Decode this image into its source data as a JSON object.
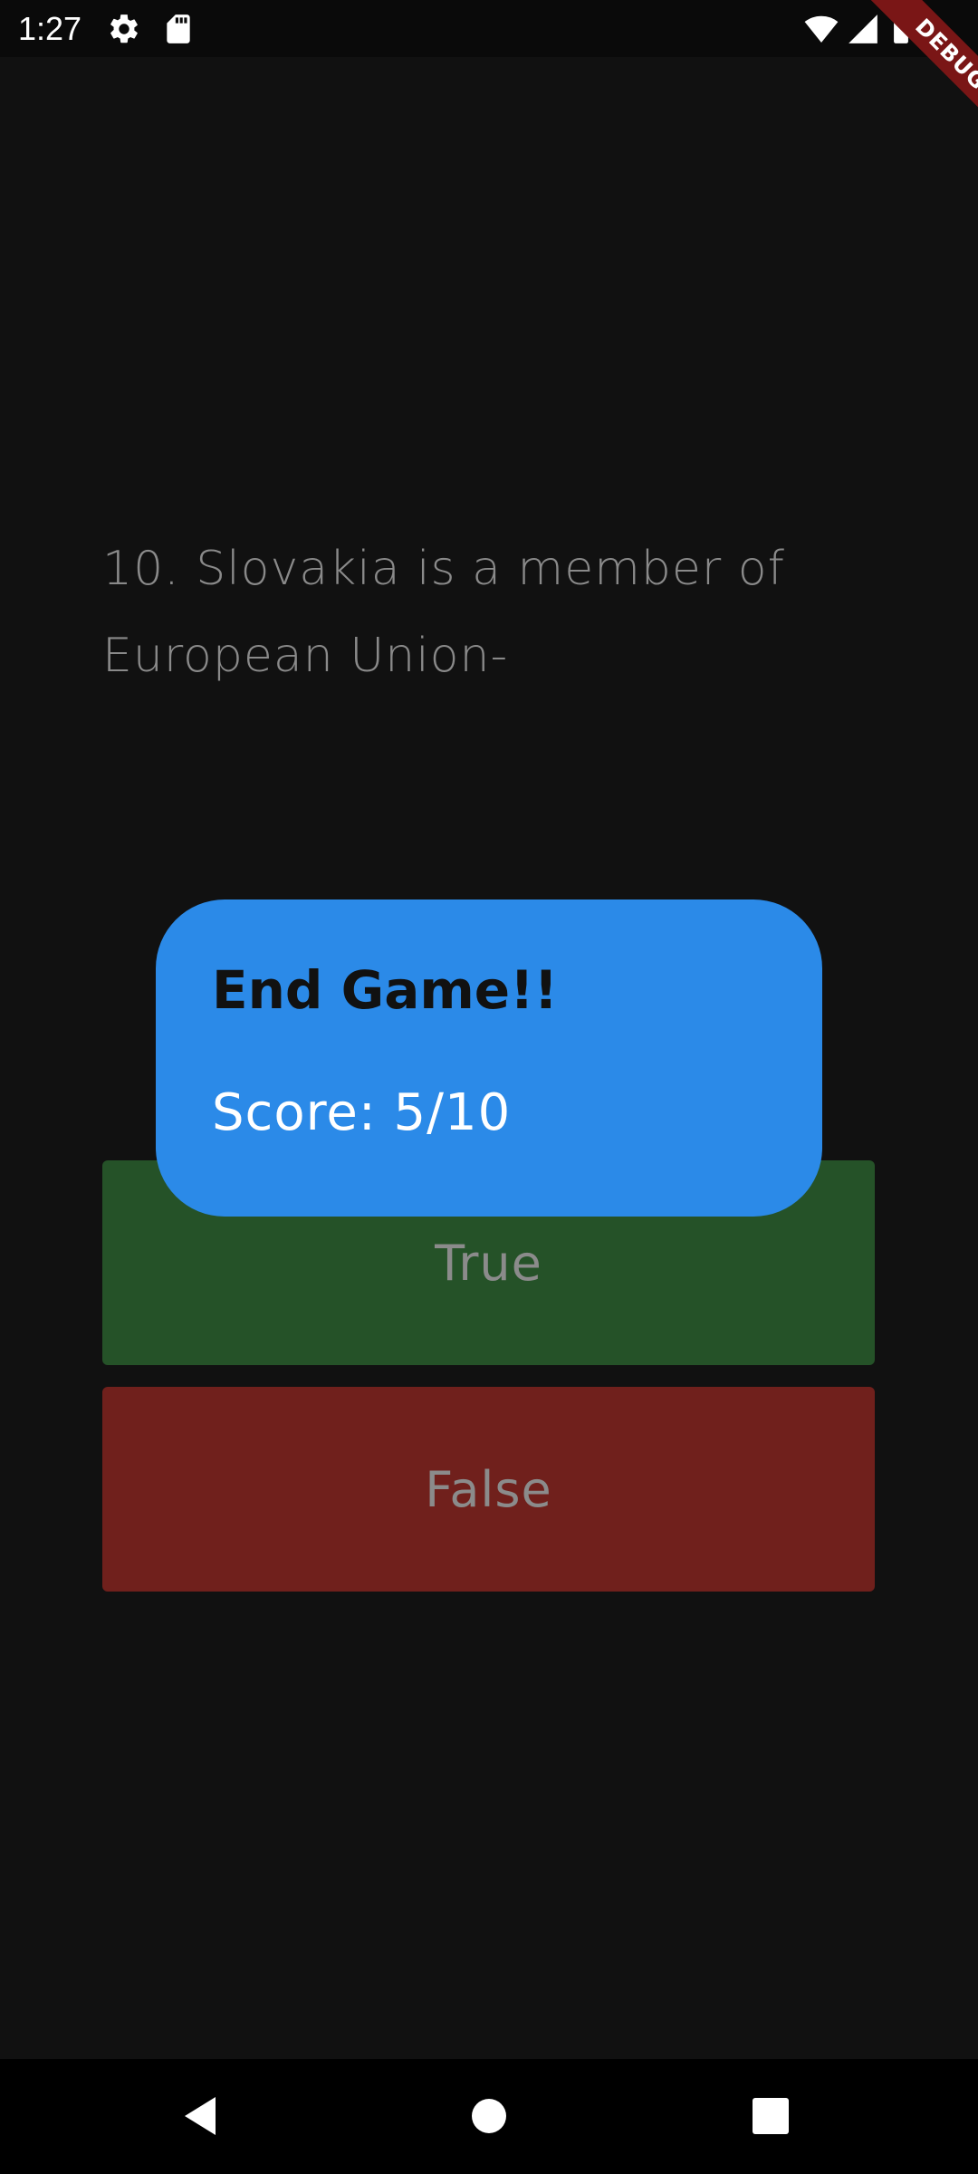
{
  "status_bar": {
    "time": "1:27",
    "icons": [
      "settings-icon",
      "sd-card-icon",
      "wifi-icon",
      "signal-icon",
      "battery-icon"
    ],
    "debug_label": "DEBUG"
  },
  "quiz": {
    "question": "10. Slovakia is a member of European Union-",
    "true_label": "True",
    "false_label": "False"
  },
  "dialog": {
    "title": "End Game!!",
    "score": "Score: 5/10"
  },
  "nav_bar": {
    "icons": [
      "back-icon",
      "home-icon",
      "recents-icon"
    ]
  },
  "colors": {
    "background": "#111111",
    "dialog": "#2b8ae8",
    "true_button": "#255228",
    "false_button": "#70201c",
    "debug_ribbon": "#7a1616"
  }
}
